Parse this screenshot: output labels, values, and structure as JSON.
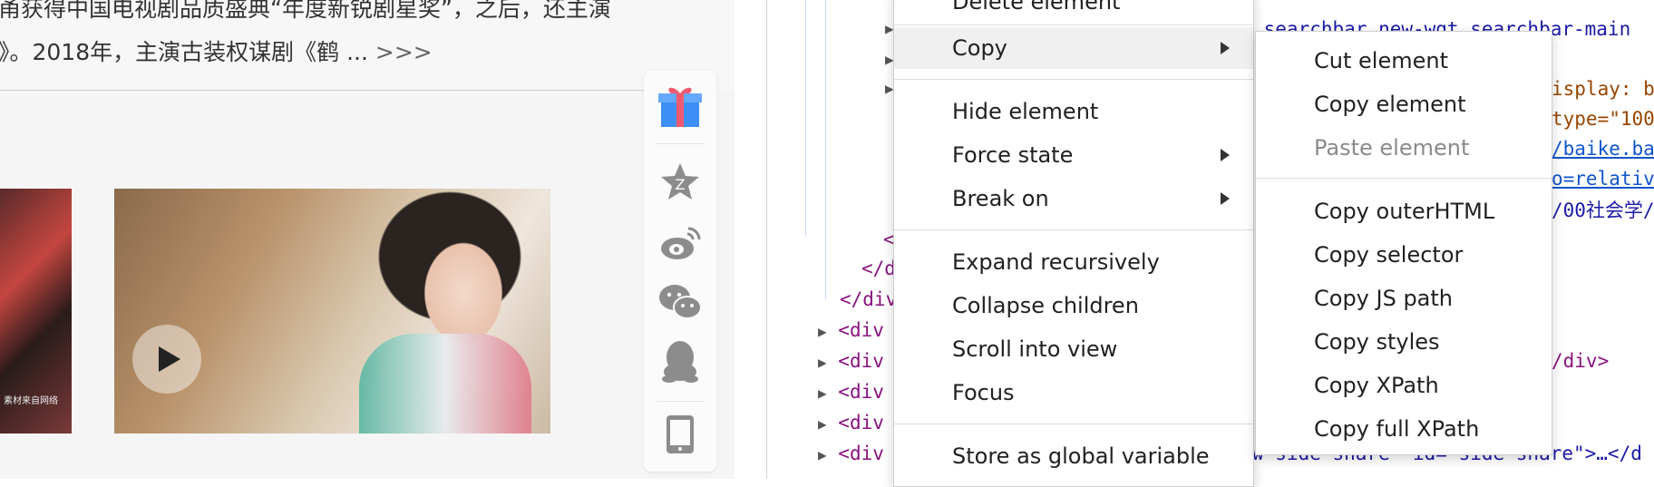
{
  "webpage": {
    "bio_line1": "甬获得中国电视剧品质盛典“年度新锐剧星奖”，之后，还主演",
    "bio_line2": "》。2018年，主演古装权谋剧《鹤 ...",
    "more_link": ">>>",
    "thumb1_watermark": "素材来自网络",
    "share": [
      "gift-icon",
      "qzone-icon",
      "weibo-icon",
      "wechat-icon",
      "qq-icon",
      "mobile-icon"
    ]
  },
  "devtools": {
    "lines": [
      {
        "text": ".searchbar new-wgt searchbar-main",
        "kind": "val"
      },
      {
        "text": "isplay: b",
        "kind": "attr"
      },
      {
        "text": "type=\"100",
        "kind": "attr"
      },
      {
        "text": "/baike.bai",
        "kind": "link"
      },
      {
        "text": "o=relativ",
        "kind": "link"
      },
      {
        "text": "/00社会学/",
        "kind": "val"
      },
      {
        "text": "</d",
        "kind": "tag"
      },
      {
        "text": "</div",
        "kind": "tag"
      },
      {
        "text": "<div",
        "kind": "tag"
      },
      {
        "text": "/div>",
        "kind": "tag"
      },
      {
        "text": "w-side-share\" id=\"side-share\">…</d",
        "kind": "tag"
      }
    ]
  },
  "context_menu": {
    "items": [
      {
        "label": "Delete element",
        "name": "menu-delete-element"
      },
      {
        "label": "Copy",
        "name": "menu-copy",
        "submenu": true,
        "highlight": true
      },
      {
        "label": "Hide element",
        "name": "menu-hide-element"
      },
      {
        "label": "Force state",
        "name": "menu-force-state",
        "submenu": true
      },
      {
        "label": "Break on",
        "name": "menu-break-on",
        "submenu": true
      },
      {
        "label": "Expand recursively",
        "name": "menu-expand-recursively"
      },
      {
        "label": "Collapse children",
        "name": "menu-collapse-children"
      },
      {
        "label": "Scroll into view",
        "name": "menu-scroll-into-view"
      },
      {
        "label": "Focus",
        "name": "menu-focus"
      },
      {
        "label": "Store as global variable",
        "name": "menu-store-global"
      }
    ]
  },
  "copy_submenu": {
    "items": [
      {
        "label": "Cut element",
        "name": "submenu-cut-element"
      },
      {
        "label": "Copy element",
        "name": "submenu-copy-element"
      },
      {
        "label": "Paste element",
        "name": "submenu-paste-element",
        "disabled": true
      },
      {
        "label": "Copy outerHTML",
        "name": "submenu-copy-outerhtml"
      },
      {
        "label": "Copy selector",
        "name": "submenu-copy-selector"
      },
      {
        "label": "Copy JS path",
        "name": "submenu-copy-js-path"
      },
      {
        "label": "Copy styles",
        "name": "submenu-copy-styles"
      },
      {
        "label": "Copy XPath",
        "name": "submenu-copy-xpath",
        "highlight": true
      },
      {
        "label": "Copy full XPath",
        "name": "submenu-copy-full-xpath"
      }
    ]
  },
  "colors": {
    "highlight_mark": "#1fd90a",
    "tag": "#881280"
  }
}
